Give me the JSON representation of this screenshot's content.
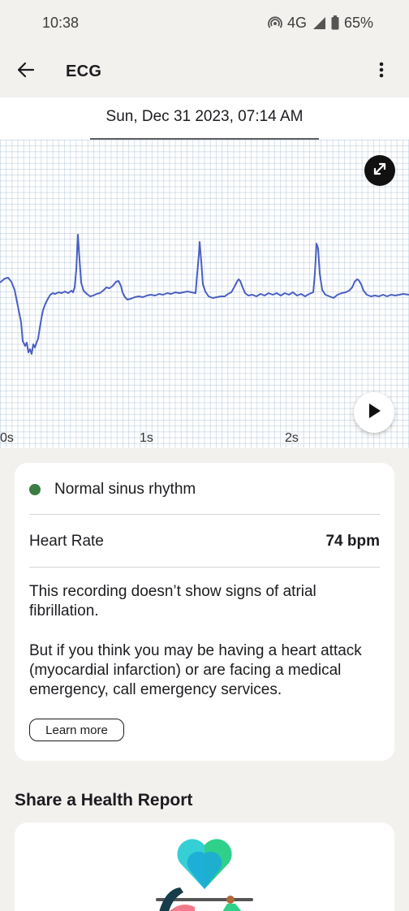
{
  "status_bar": {
    "time": "10:38",
    "network": "4G",
    "battery": "65%",
    "icons": [
      "hotspot-icon",
      "signal-icon",
      "battery-icon"
    ]
  },
  "app_bar": {
    "title": "ECG",
    "back_icon": "arrow-left-icon",
    "menu_icon": "more-vert-icon"
  },
  "recording": {
    "date": "Sun, Dec 31 2023, 07:14 AM"
  },
  "ecg": {
    "time_labels": [
      "0s",
      "1s",
      "2s"
    ],
    "trace_color": "#4a5fc1",
    "controls": [
      "expand-icon",
      "play-icon"
    ]
  },
  "result": {
    "rhythm": "Normal sinus rhythm",
    "rhythm_color": "#3b7d44",
    "heart_rate_label": "Heart Rate",
    "heart_rate_value": "74 bpm",
    "paragraph1": "This recording doesn’t show signs of atrial fibrillation.",
    "paragraph2": "But if you think you may be having a heart attack (myocardial infarction) or are facing a medical emergency, call emergency services.",
    "learn_more": "Learn more"
  },
  "share": {
    "title": "Share a Health Report",
    "illustration": "heart-illustration"
  }
}
